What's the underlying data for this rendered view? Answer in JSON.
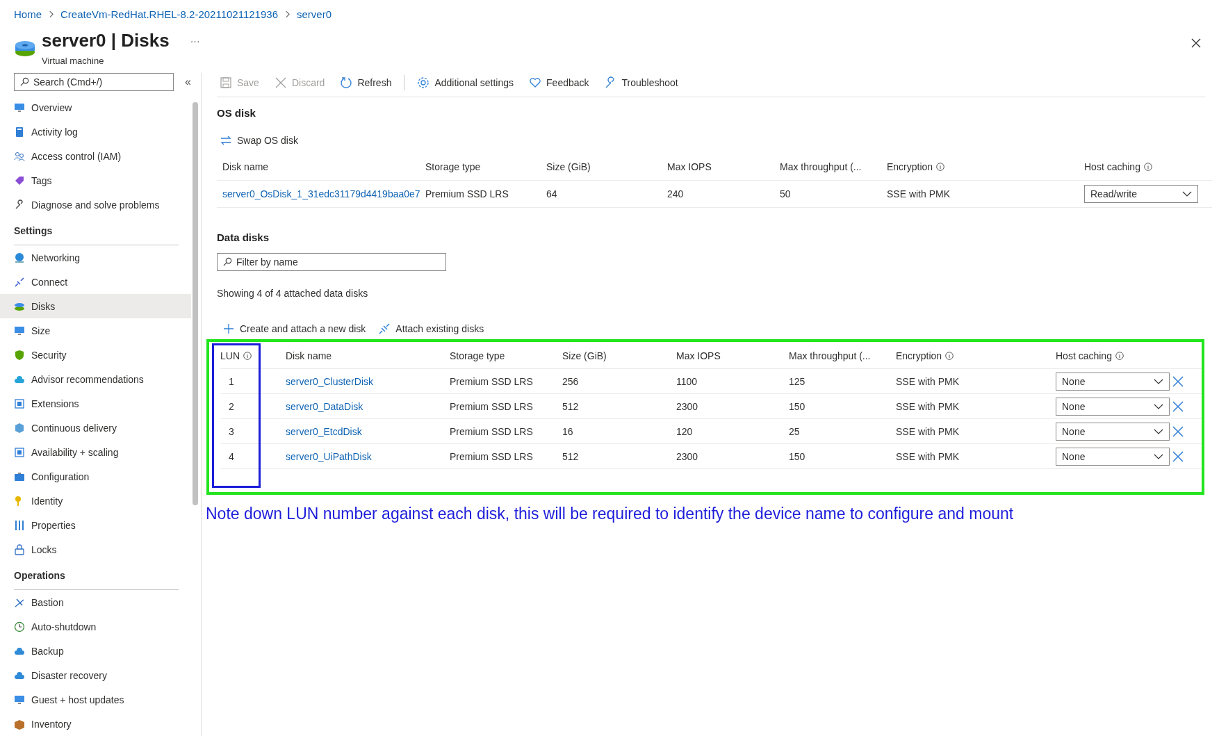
{
  "breadcrumb": [
    {
      "label": "Home"
    },
    {
      "label": "CreateVm-RedHat.RHEL-8.2-20211021121936"
    },
    {
      "label": "server0"
    }
  ],
  "header": {
    "title": "server0 | Disks",
    "subtitle": "Virtual machine",
    "more": "···"
  },
  "sidebar": {
    "search": {
      "placeholder": "Search (Cmd+/)"
    },
    "collapse": "«",
    "groups": [
      {
        "items": [
          {
            "label": "Overview",
            "selected": false
          },
          {
            "label": "Activity log",
            "selected": false
          },
          {
            "label": "Access control (IAM)",
            "selected": false
          },
          {
            "label": "Tags",
            "selected": false
          },
          {
            "label": "Diagnose and solve problems",
            "selected": false
          }
        ]
      },
      {
        "heading": "Settings",
        "items": [
          {
            "label": "Networking",
            "selected": false
          },
          {
            "label": "Connect",
            "selected": false
          },
          {
            "label": "Disks",
            "selected": true
          },
          {
            "label": "Size",
            "selected": false
          },
          {
            "label": "Security",
            "selected": false
          },
          {
            "label": "Advisor recommendations",
            "selected": false
          },
          {
            "label": "Extensions",
            "selected": false
          },
          {
            "label": "Continuous delivery",
            "selected": false
          },
          {
            "label": "Availability + scaling",
            "selected": false
          },
          {
            "label": "Configuration",
            "selected": false
          },
          {
            "label": "Identity",
            "selected": false
          },
          {
            "label": "Properties",
            "selected": false
          },
          {
            "label": "Locks",
            "selected": false
          }
        ]
      },
      {
        "heading": "Operations",
        "items": [
          {
            "label": "Bastion",
            "selected": false
          },
          {
            "label": "Auto-shutdown",
            "selected": false
          },
          {
            "label": "Backup",
            "selected": false
          },
          {
            "label": "Disaster recovery",
            "selected": false
          },
          {
            "label": "Guest + host updates",
            "selected": false
          },
          {
            "label": "Inventory",
            "selected": false
          }
        ]
      }
    ]
  },
  "toolbar": [
    {
      "kind": "save",
      "label": "Save",
      "disabled": true
    },
    {
      "kind": "discard",
      "label": "Discard",
      "disabled": true
    },
    {
      "kind": "refresh",
      "label": "Refresh",
      "disabled": false
    },
    {
      "kind": "settings",
      "label": "Additional settings",
      "disabled": false
    },
    {
      "kind": "feedback",
      "label": "Feedback",
      "disabled": false
    },
    {
      "kind": "troubleshoot",
      "label": "Troubleshoot",
      "disabled": false
    }
  ],
  "os_disk": {
    "heading": "OS disk",
    "action": "Swap OS disk",
    "columns": [
      {
        "label": "Disk name",
        "info": false
      },
      {
        "label": "Storage type",
        "info": false
      },
      {
        "label": "Size (GiB)",
        "info": false
      },
      {
        "label": "Max IOPS",
        "info": false
      },
      {
        "label": "Max throughput (...",
        "info": false
      },
      {
        "label": "Encryption",
        "info": true
      },
      {
        "label": "Host caching",
        "info": true
      }
    ],
    "rows": [
      {
        "name": "server0_OsDisk_1_31edc31179d4419baa0e7",
        "storage": "Premium SSD LRS",
        "size": "64",
        "iops": "240",
        "throughput": "50",
        "encryption": "SSE with PMK",
        "caching": "Read/write"
      }
    ]
  },
  "data_disks": {
    "heading": "Data disks",
    "filter": {
      "placeholder": "Filter by name"
    },
    "summary": "Showing 4 of 4 attached data disks",
    "actions": [
      {
        "kind": "add",
        "label": "Create and attach a new disk"
      },
      {
        "kind": "attach",
        "label": "Attach existing disks"
      }
    ],
    "columns": [
      {
        "label": "LUN",
        "info": true
      },
      {
        "label": "Disk name",
        "info": false
      },
      {
        "label": "Storage type",
        "info": false
      },
      {
        "label": "Size (GiB)",
        "info": false
      },
      {
        "label": "Max IOPS",
        "info": false
      },
      {
        "label": "Max throughput (...",
        "info": false
      },
      {
        "label": "Encryption",
        "info": true
      },
      {
        "label": "Host caching",
        "info": true
      }
    ],
    "rows": [
      {
        "lun": "1",
        "name": "server0_ClusterDisk",
        "storage": "Premium SSD LRS",
        "size": "256",
        "iops": "1100",
        "throughput": "125",
        "encryption": "SSE with PMK",
        "caching": "None"
      },
      {
        "lun": "2",
        "name": "server0_DataDisk",
        "storage": "Premium SSD LRS",
        "size": "512",
        "iops": "2300",
        "throughput": "150",
        "encryption": "SSE with PMK",
        "caching": "None"
      },
      {
        "lun": "3",
        "name": "server0_EtcdDisk",
        "storage": "Premium SSD LRS",
        "size": "16",
        "iops": "120",
        "throughput": "25",
        "encryption": "SSE with PMK",
        "caching": "None"
      },
      {
        "lun": "4",
        "name": "server0_UiPathDisk",
        "storage": "Premium SSD LRS",
        "size": "512",
        "iops": "2300",
        "throughput": "150",
        "encryption": "SSE with PMK",
        "caching": "None"
      }
    ]
  },
  "note": "Note down LUN number against each disk, this will be required to identify the device name to configure and mount"
}
